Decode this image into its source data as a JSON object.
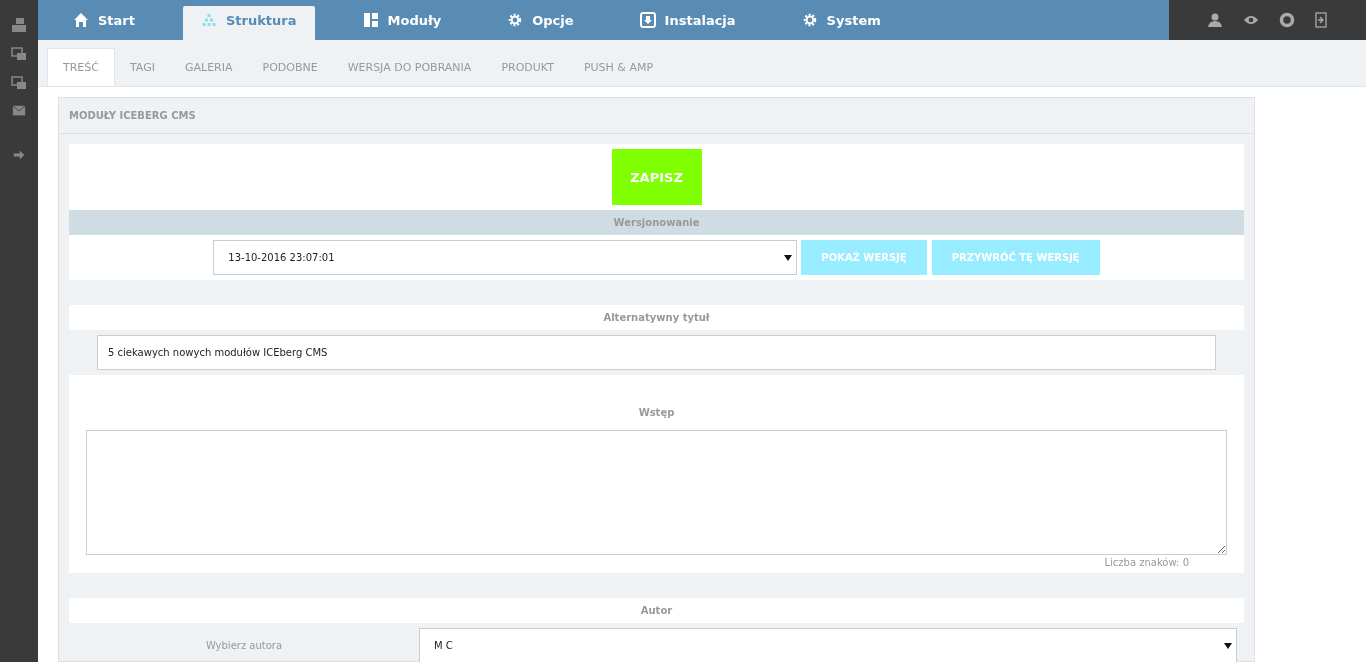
{
  "top_nav": [
    {
      "label": "Start",
      "selected": false
    },
    {
      "label": "Struktura",
      "selected": true
    },
    {
      "label": "Moduły",
      "selected": false
    },
    {
      "label": "Opcje",
      "selected": false
    },
    {
      "label": "Instalacja",
      "selected": false
    },
    {
      "label": "System",
      "selected": false
    }
  ],
  "sub_tabs": [
    {
      "label": "TREŚĆ",
      "selected": true
    },
    {
      "label": "TAGI",
      "selected": false
    },
    {
      "label": "GALERIA",
      "selected": false
    },
    {
      "label": "PODOBNE",
      "selected": false
    },
    {
      "label": "WERSJA DO POBRANIA",
      "selected": false
    },
    {
      "label": "PRODUKT",
      "selected": false
    },
    {
      "label": "PUSH & AMP",
      "selected": false
    }
  ],
  "panel": {
    "title": "MODUŁY ICEBERG CMS",
    "save_button": "ZAPISZ",
    "versioning": {
      "heading": "Wersjonowanie",
      "value": "13-10-2016 23:07:01",
      "buttons": [
        "POKAŻ WERSJĘ",
        "PRZYWRÓĆ TĘ WERSJĘ"
      ]
    },
    "alt_title": {
      "heading": "Alternatywny tytuł",
      "value": "5 ciekawych nowych modułów ICEberg CMS"
    },
    "intro": {
      "heading": "Wstęp",
      "char_count": "Liczba znaków: 0"
    },
    "author": {
      "heading": "Autor",
      "label": "Wybierz autora",
      "value": "M C"
    }
  }
}
